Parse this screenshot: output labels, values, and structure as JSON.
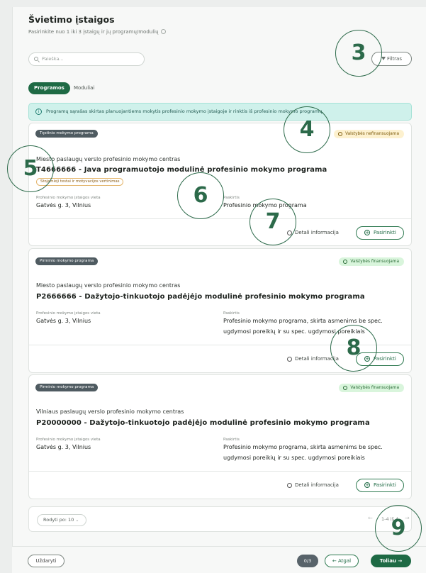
{
  "header": {
    "title": "Švietimo įstaigos",
    "subtitle": "Pasirinkite nuo 1 iki 3 įstaigų ir jų programų/modulių"
  },
  "search": {
    "placeholder": "Paieška..."
  },
  "filter_label": "Filtras",
  "tabs": [
    {
      "label": "Programos",
      "active": true
    },
    {
      "label": "Moduliai",
      "active": false
    }
  ],
  "alert": "Programų sąrašas skirtas planuojantiems mokytis profesinio mokymo įstaigoje ir rinktis iš profesinio mokymo programų.",
  "cards": [
    {
      "type": "Tęstinio mokymo programa",
      "funding": "Valstybės nefinansuojama",
      "institution": "Miesto paslaugų verslo profesinio mokymo centras",
      "program": "T4666666 - Java programuotojo modulinė profesinio mokymo programa",
      "entry_badge": "Stojamieji testai ir motyvacijos vertinimas",
      "location_label": "Profesinio mokymo įstaigos vieta",
      "location": "Gatvės g. 3, Vilnius",
      "purpose_label": "Paskirtis",
      "purpose": "Profesinio mokymo programa",
      "details": "Detali informacija",
      "select": "Pasirinkti"
    },
    {
      "type": "Pirminio mokymo programa",
      "funding": "Valstybės finansuojama",
      "institution": "Miesto paslaugų verslo profesinio mokymo centras",
      "program": "P2666666 - Dažytojo-tinkuotojo padėjėjo modulinė profesinio mokymo programa",
      "location_label": "Profesinio mokymo įstaigos vieta",
      "location": "Gatvės g. 3, Vilnius",
      "purpose_label": "Paskirtis",
      "purpose_line1": "Profesinio mokymo programa, skirta asmenims be spec.",
      "purpose_line2": "ugdymosi poreikių ir su spec. ugdymosi poreikiais",
      "details": "Detali informacija",
      "select": "Pasirinkti"
    },
    {
      "type": "Pirminio mokymo programa",
      "funding": "Valstybės finansuojama",
      "institution": "Vilniaus paslaugų verslo profesinio mokymo centras",
      "program": "P20000000 - Dažytojo-tinkuotojo padėjėjo modulinė profesinio mokymo programa",
      "location_label": "Profesinio mokymo įstaigos vieta",
      "location": "Gatvės g. 3, Vilnius",
      "purpose_label": "Paskirtis",
      "purpose_line1": "Profesinio mokymo programa, skirta asmenims be spec.",
      "purpose_line2": "ugdymosi poreikių ir su spec. ugdymosi poreikiais",
      "details": "Detali informacija",
      "select": "Pasirinkti"
    }
  ],
  "pager": {
    "page_size": "Rodyti po: 10",
    "range": "1-4 iš 4",
    "prev": "←",
    "next": "→"
  },
  "footer": {
    "close": "Uždaryti",
    "step": "0/3",
    "back": "Atgal",
    "next": "Toliau"
  },
  "markers": [
    "3",
    "4",
    "5",
    "6",
    "7",
    "8",
    "9"
  ],
  "colors": {
    "primary": "#1e6a44",
    "alert_bg": "#cff1eb"
  }
}
